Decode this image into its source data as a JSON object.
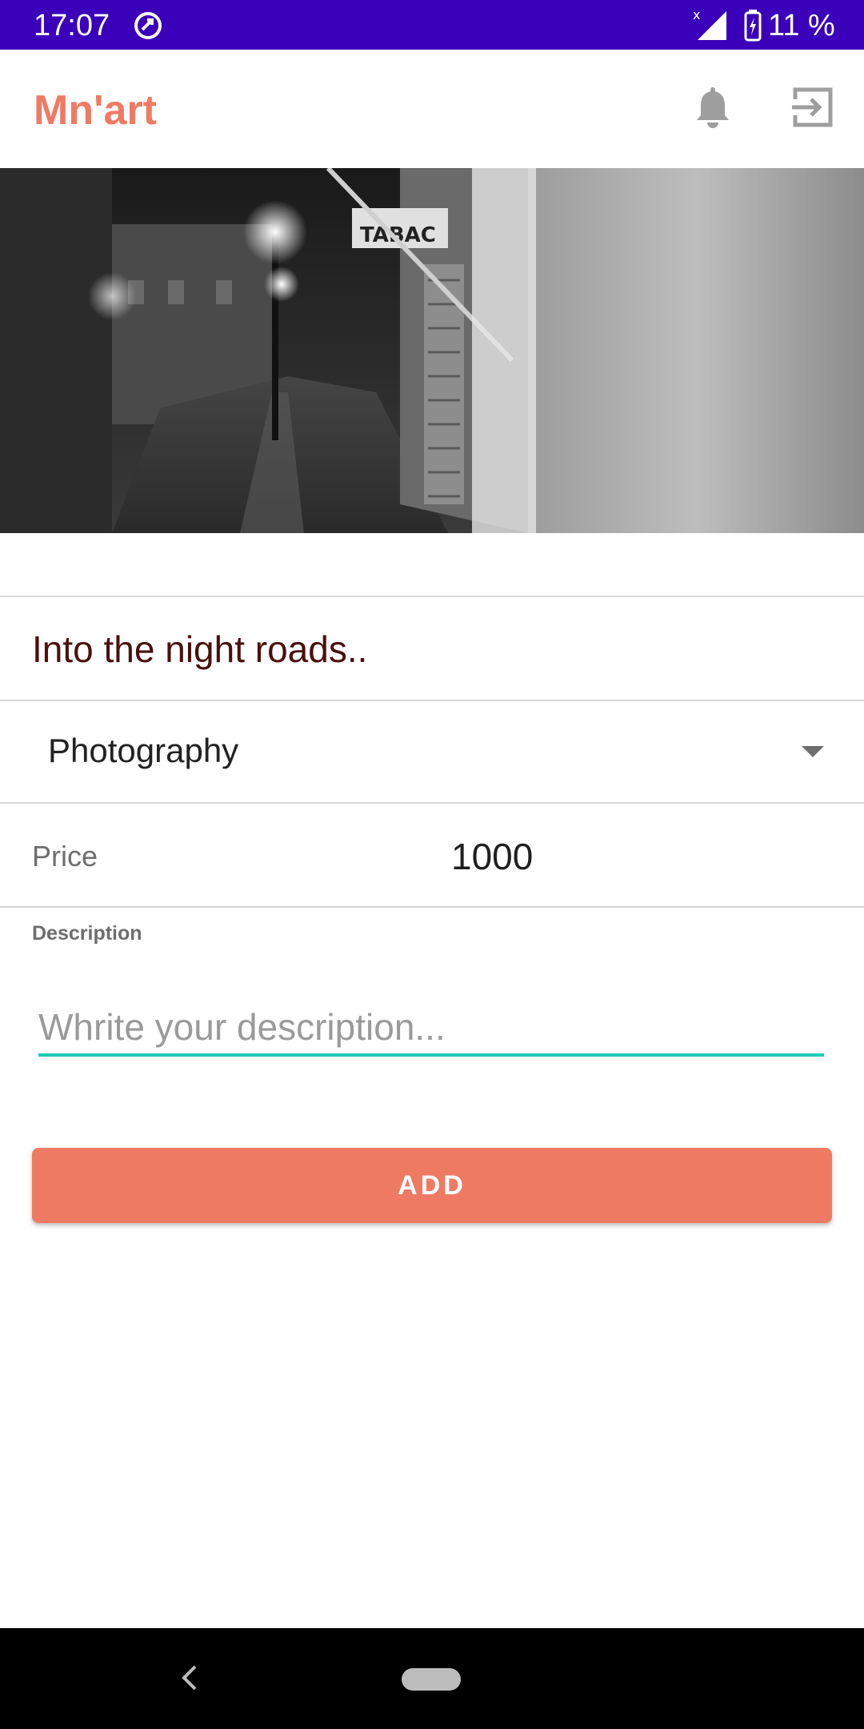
{
  "status_bar": {
    "time": "17:07",
    "battery": "11 %",
    "background": "#3b00b9",
    "icons": [
      "app-notification-icon",
      "signal-icon",
      "battery-charging-icon"
    ]
  },
  "app_bar": {
    "title": "Mn'art",
    "title_color": "#ef7a64",
    "actions": [
      "bell-icon",
      "exit-icon"
    ]
  },
  "artwork": {
    "image": "black-and-white night street photo",
    "title": "Into the night roads..",
    "category": "Photography",
    "price_label": "Price",
    "price_value": "1000",
    "description_label": "Description",
    "description_placeholder": "Whrite your description...",
    "description_value": ""
  },
  "actions": {
    "add_label": "ADD",
    "add_color": "#ef7a64"
  },
  "accent": "#1ec9b8",
  "nav_bar": {
    "icons": [
      "back-icon",
      "home-pill"
    ]
  }
}
